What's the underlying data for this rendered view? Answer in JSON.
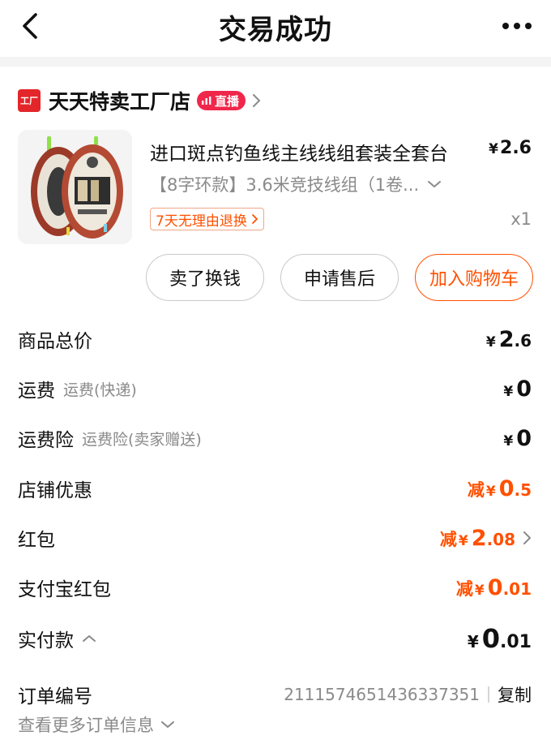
{
  "header": {
    "title": "交易成功",
    "back_icon": "chevron-left-icon",
    "more_icon": "more-dots-icon"
  },
  "shop": {
    "logo_text": "工厂",
    "name": "天天特卖工厂店",
    "live_badge": "直播",
    "logo_color": "#e3262a",
    "badge_color": "#f0274b"
  },
  "product": {
    "name": "进口斑点钓鱼线主线线组套装全套台",
    "price_symbol": "¥",
    "price": "2.6",
    "sku": "【8字环款】3.6米竞技线组（1卷...",
    "return_tag": "7天无理由退换",
    "quantity": "x1"
  },
  "actions": {
    "resell": "卖了换钱",
    "after_sale": "申请售后",
    "add_to_cart": "加入购物车",
    "accent_color": "#ff5000"
  },
  "summary": {
    "currency": "¥",
    "reduce_label": "减",
    "goods_total": {
      "label": "商品总价",
      "int": "2",
      "dec": ".6"
    },
    "shipping": {
      "label": "运费",
      "sub": "运费(快递)",
      "value": "0"
    },
    "shipping_insurance": {
      "label": "运费险",
      "sub": "运费险(卖家赠送)",
      "value": "0"
    },
    "shop_discount": {
      "label": "店铺优惠",
      "int": "0",
      "dec": ".5"
    },
    "red_packet": {
      "label": "红包",
      "int": "2",
      "dec": ".08"
    },
    "alipay_red_packet": {
      "label": "支付宝红包",
      "int": "0",
      "dec": ".01"
    },
    "paid": {
      "label": "实付款",
      "int": "0",
      "dec": ".01"
    }
  },
  "order": {
    "label": "订单编号",
    "number": "2111574651436337351",
    "copy": "复制",
    "more_info": "查看更多订单信息"
  }
}
